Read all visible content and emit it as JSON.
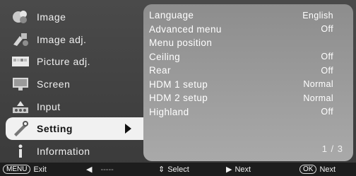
{
  "left_menu": [
    {
      "label": "Image",
      "icon": "image-icon"
    },
    {
      "label": "Image adj.",
      "icon": "image-adj-icon"
    },
    {
      "label": "Picture adj.",
      "icon": "picture-adj-icon"
    },
    {
      "label": "Screen",
      "icon": "screen-icon"
    },
    {
      "label": "Input",
      "icon": "input-icon"
    },
    {
      "label": "Setting",
      "icon": "setting-icon",
      "selected": true
    },
    {
      "label": "Information",
      "icon": "information-icon"
    }
  ],
  "settings": [
    {
      "label": "Language",
      "value": "English"
    },
    {
      "label": "Advanced menu",
      "value": "Off"
    },
    {
      "label": "Menu position",
      "value": ""
    },
    {
      "label": "Ceiling",
      "value": "Off"
    },
    {
      "label": "Rear",
      "value": "Off"
    },
    {
      "label": "HDM 1 setup",
      "value": "Normal"
    },
    {
      "label": "HDM 2 setup",
      "value": "Normal"
    },
    {
      "label": "Highland",
      "value": "Off"
    }
  ],
  "page_indicator": "1 / 3",
  "bottom_bar": {
    "menu_key": "MENU",
    "exit_label": "Exit",
    "back_dashes": "-----",
    "select_label": "Select",
    "next_label": "Next",
    "ok_key": "OK",
    "ok_next_label": "Next"
  },
  "colors": {
    "background": "#3f3f3f",
    "panel": "#9b9b9b",
    "selected_bg": "#f1f1f1",
    "bottom_bar": "#1d1d1d"
  }
}
